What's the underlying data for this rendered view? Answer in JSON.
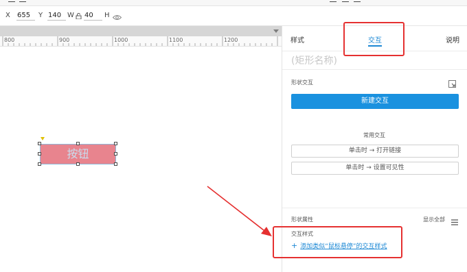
{
  "toolbar": {
    "x_label": "X",
    "x_value": "655",
    "y_label": "Y",
    "y_value": "140",
    "w_label": "W",
    "w_value": "40",
    "h_label": "H"
  },
  "ruler": {
    "ticks": [
      "800",
      "900",
      "1000",
      "1100",
      "1200"
    ]
  },
  "widget": {
    "label": "按钮"
  },
  "panel": {
    "tabs": {
      "style": "样式",
      "interaction": "交互",
      "notes": "说明"
    },
    "shape_name_placeholder": "(矩形名称)",
    "shape_interaction_label": "形状交互",
    "new_interaction_button": "新建交互",
    "common_interactions_label": "常用交互",
    "common_interactions": [
      "单击时 → 打开链接",
      "单击时 → 设置可见性"
    ],
    "shape_properties_label": "形状属性",
    "show_all_label": "显示全部",
    "interaction_style_label": "交互样式",
    "add_style_link": "添加类似“鼠标悬停”的交互样式"
  },
  "colors": {
    "accent": "#1a91df",
    "widget_fill": "#e8848e",
    "annotation": "#e53030"
  }
}
